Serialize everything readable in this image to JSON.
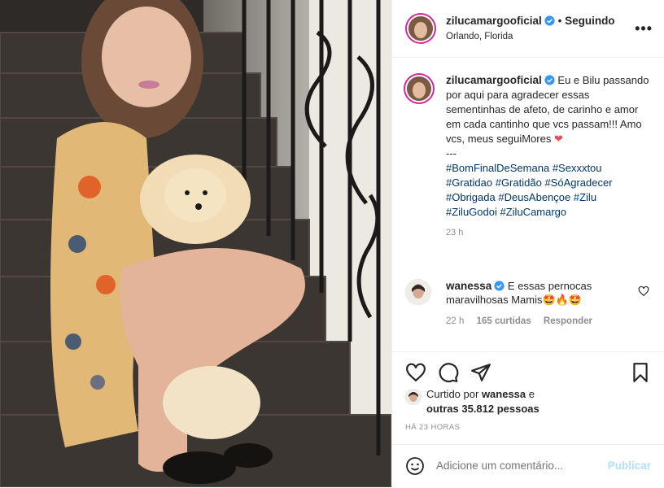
{
  "post": {
    "author": "zilucamargooficial",
    "separator": "•",
    "follow_state": "Seguindo",
    "location": "Orlando, Florida",
    "more_label": "•••",
    "caption_author": "zilucamargooficial",
    "caption_text": "Eu e Bilu passando por aqui para agradecer essas sementinhas de afeto, de carinho e amor em cada cantinho que vcs passam!!! Amo vcs, meus seguiMores",
    "caption_heart": "❤",
    "caption_sep": "---",
    "hashtags": [
      "#BomFinalDeSemana",
      "#Sexxxtou",
      "#Gratidao",
      "#Gratidão",
      "#SóAgradecer",
      "#Obrigada",
      "#DeusAbençoe",
      "#Zilu",
      "#ZiluGodoi",
      "#ZiluCamargo"
    ],
    "caption_time": "23 h"
  },
  "comment": {
    "author": "wanessa",
    "text": "E essas pernocas maravilhosas Mamis",
    "emojis": "🤩🔥🤩",
    "time": "22 h",
    "likes": "165 curtidas",
    "reply": "Responder"
  },
  "likes": {
    "prefix": "Curtido por",
    "user": "wanessa",
    "middle": "e",
    "others": "outras 35.812 pessoas"
  },
  "date": "HÁ 23 HORAS",
  "add_comment": {
    "placeholder": "Adicione um comentário...",
    "publish": "Publicar"
  },
  "colors": {
    "link": "#00376b",
    "verified": "#3897f0",
    "publish_disabled": "#b2dffc"
  }
}
